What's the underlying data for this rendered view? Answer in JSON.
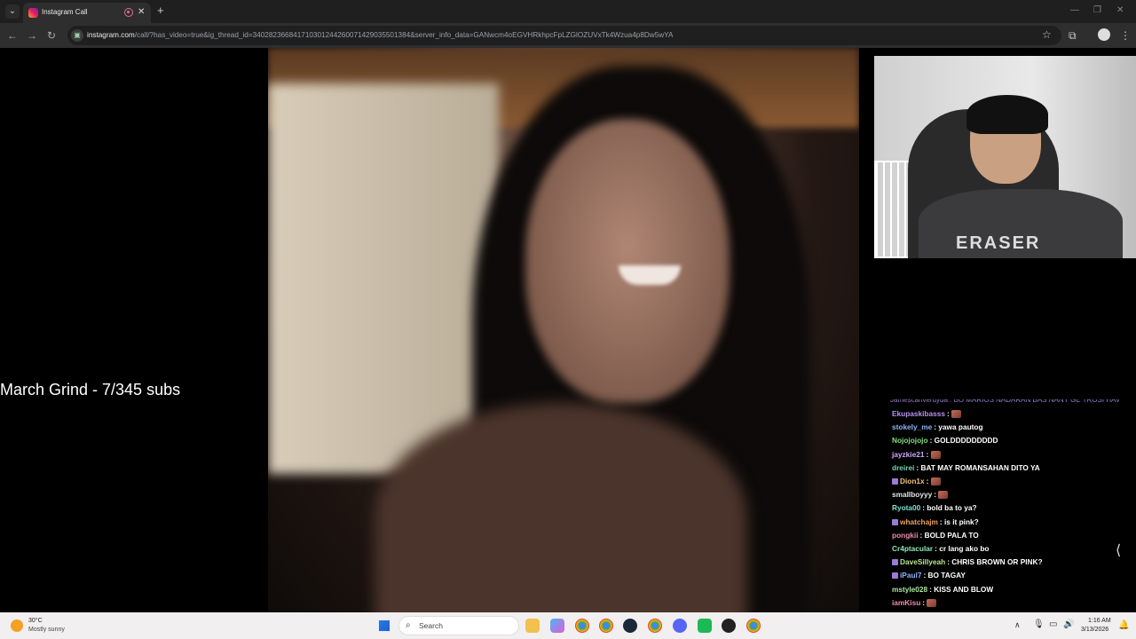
{
  "browser": {
    "tab_title": "Instagram Call",
    "url_host": "instagram.com",
    "url_path": "/call/?has_video=true&ig_thread_id=340282366841710301244260071429035501384&server_info_data=GANwcm4oEGVHRkhpcFpLZGlOZUVxTk4Wzua4p8Dw5wYA"
  },
  "stream": {
    "overlay_text": "March Grind - 7/345 subs",
    "webcam_shirt_text": "ERASER"
  },
  "chat": {
    "clipped_line": "Jamescanverdyda : BO MARIOS NADARAN BAS NANY GE TROSI HAV",
    "messages": [
      {
        "user": "Ekupaskibasss",
        "text": "",
        "user_color": "#b98ff0",
        "emote": true,
        "badge": false
      },
      {
        "user": "stokely_me",
        "text": "yawa pautog",
        "user_color": "#8ab4f8",
        "emote": false,
        "badge": false
      },
      {
        "user": "Nojojojojo",
        "text": "GOLDDDDDDDDD",
        "user_color": "#7ee07e",
        "emote": false,
        "badge": false
      },
      {
        "user": "jayzkie21",
        "text": "",
        "user_color": "#cfa8ff",
        "emote": true,
        "badge": false
      },
      {
        "user": "dreirei",
        "text": "BAT MAY ROMANSAHAN DITO YA",
        "user_color": "#6fd6b0",
        "emote": false,
        "badge": false
      },
      {
        "user": "Dion1x",
        "text": "",
        "user_color": "#f1c27d",
        "emote": true,
        "badge": true
      },
      {
        "user": "smallboyyy",
        "text": "",
        "user_color": "#e6e6e6",
        "emote": true,
        "badge": false
      },
      {
        "user": "Ryota00",
        "text": "bold ba to ya?",
        "user_color": "#7ee0d3",
        "emote": false,
        "badge": false
      },
      {
        "user": "whatchajm",
        "text": "is it pink?",
        "user_color": "#f0a35a",
        "emote": false,
        "badge": true
      },
      {
        "user": "pongkii",
        "text": "BOLD PALA TO",
        "user_color": "#f08bb0",
        "emote": false,
        "badge": false
      },
      {
        "user": "Cr4ptacular",
        "text": "cr lang ako bo",
        "user_color": "#8ee6b4",
        "emote": false,
        "badge": false
      },
      {
        "user": "DaveSillyeah",
        "text": "CHRIS BROWN OR PINK?",
        "user_color": "#b7e68e",
        "emote": false,
        "badge": true
      },
      {
        "user": "iPaul7",
        "text": "BO TAGAY",
        "user_color": "#8ab4f8",
        "emote": false,
        "badge": true
      },
      {
        "user": "mstyle028",
        "text": "KISS AND BLOW",
        "user_color": "#a8e6a0",
        "emote": false,
        "badge": false
      },
      {
        "user": "iamKisu",
        "text": "",
        "user_color": "#f08bb0",
        "emote": true,
        "badge": false
      }
    ]
  },
  "taskbar": {
    "weather_temp": "30°C",
    "weather_desc": "Mostly sunny",
    "search_placeholder": "Search",
    "clock_time": "1:16 AM",
    "clock_date": "3/13/2026"
  },
  "colors": {
    "browser_frame": "#1f1f1f",
    "taskbar": "#f1efef",
    "accent": "#e46a8e"
  }
}
